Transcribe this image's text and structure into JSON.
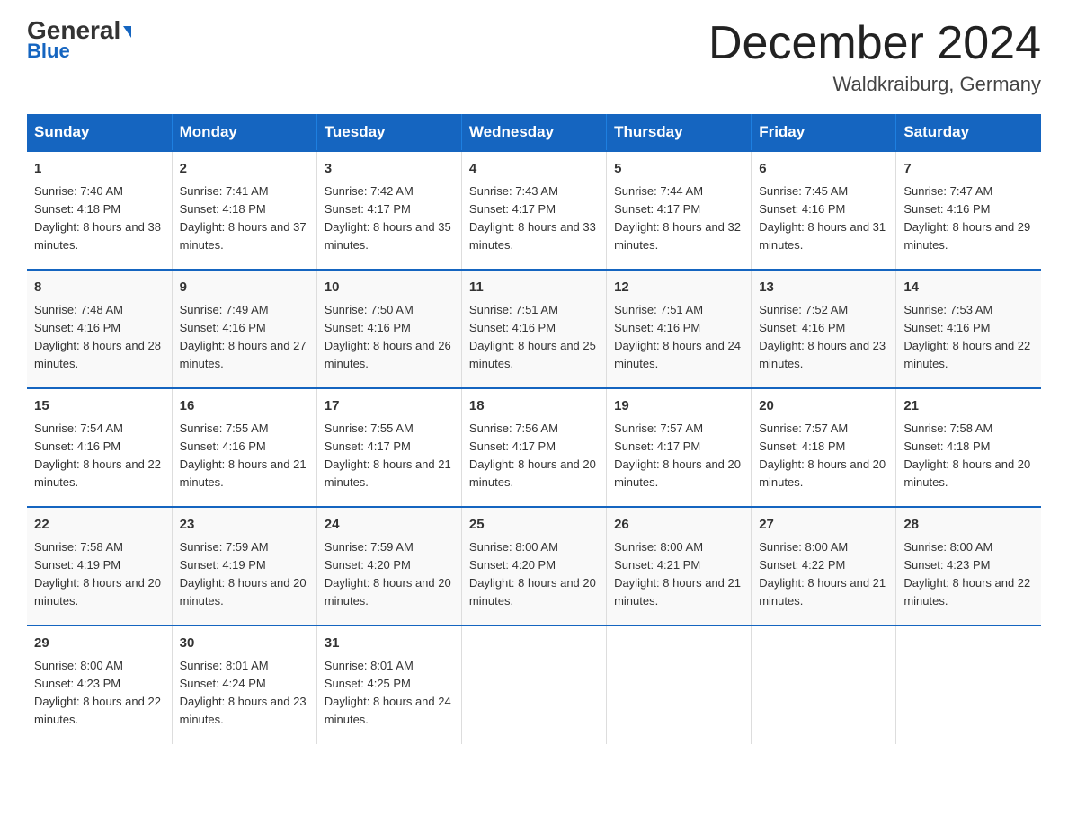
{
  "logo": {
    "general": "General",
    "arrow": "▶",
    "blue": "Blue"
  },
  "header": {
    "month": "December 2024",
    "location": "Waldkraiburg, Germany"
  },
  "days_of_week": [
    "Sunday",
    "Monday",
    "Tuesday",
    "Wednesday",
    "Thursday",
    "Friday",
    "Saturday"
  ],
  "weeks": [
    [
      {
        "day": "1",
        "sunrise": "7:40 AM",
        "sunset": "4:18 PM",
        "daylight": "8 hours and 38 minutes."
      },
      {
        "day": "2",
        "sunrise": "7:41 AM",
        "sunset": "4:18 PM",
        "daylight": "8 hours and 37 minutes."
      },
      {
        "day": "3",
        "sunrise": "7:42 AM",
        "sunset": "4:17 PM",
        "daylight": "8 hours and 35 minutes."
      },
      {
        "day": "4",
        "sunrise": "7:43 AM",
        "sunset": "4:17 PM",
        "daylight": "8 hours and 33 minutes."
      },
      {
        "day": "5",
        "sunrise": "7:44 AM",
        "sunset": "4:17 PM",
        "daylight": "8 hours and 32 minutes."
      },
      {
        "day": "6",
        "sunrise": "7:45 AM",
        "sunset": "4:16 PM",
        "daylight": "8 hours and 31 minutes."
      },
      {
        "day": "7",
        "sunrise": "7:47 AM",
        "sunset": "4:16 PM",
        "daylight": "8 hours and 29 minutes."
      }
    ],
    [
      {
        "day": "8",
        "sunrise": "7:48 AM",
        "sunset": "4:16 PM",
        "daylight": "8 hours and 28 minutes."
      },
      {
        "day": "9",
        "sunrise": "7:49 AM",
        "sunset": "4:16 PM",
        "daylight": "8 hours and 27 minutes."
      },
      {
        "day": "10",
        "sunrise": "7:50 AM",
        "sunset": "4:16 PM",
        "daylight": "8 hours and 26 minutes."
      },
      {
        "day": "11",
        "sunrise": "7:51 AM",
        "sunset": "4:16 PM",
        "daylight": "8 hours and 25 minutes."
      },
      {
        "day": "12",
        "sunrise": "7:51 AM",
        "sunset": "4:16 PM",
        "daylight": "8 hours and 24 minutes."
      },
      {
        "day": "13",
        "sunrise": "7:52 AM",
        "sunset": "4:16 PM",
        "daylight": "8 hours and 23 minutes."
      },
      {
        "day": "14",
        "sunrise": "7:53 AM",
        "sunset": "4:16 PM",
        "daylight": "8 hours and 22 minutes."
      }
    ],
    [
      {
        "day": "15",
        "sunrise": "7:54 AM",
        "sunset": "4:16 PM",
        "daylight": "8 hours and 22 minutes."
      },
      {
        "day": "16",
        "sunrise": "7:55 AM",
        "sunset": "4:16 PM",
        "daylight": "8 hours and 21 minutes."
      },
      {
        "day": "17",
        "sunrise": "7:55 AM",
        "sunset": "4:17 PM",
        "daylight": "8 hours and 21 minutes."
      },
      {
        "day": "18",
        "sunrise": "7:56 AM",
        "sunset": "4:17 PM",
        "daylight": "8 hours and 20 minutes."
      },
      {
        "day": "19",
        "sunrise": "7:57 AM",
        "sunset": "4:17 PM",
        "daylight": "8 hours and 20 minutes."
      },
      {
        "day": "20",
        "sunrise": "7:57 AM",
        "sunset": "4:18 PM",
        "daylight": "8 hours and 20 minutes."
      },
      {
        "day": "21",
        "sunrise": "7:58 AM",
        "sunset": "4:18 PM",
        "daylight": "8 hours and 20 minutes."
      }
    ],
    [
      {
        "day": "22",
        "sunrise": "7:58 AM",
        "sunset": "4:19 PM",
        "daylight": "8 hours and 20 minutes."
      },
      {
        "day": "23",
        "sunrise": "7:59 AM",
        "sunset": "4:19 PM",
        "daylight": "8 hours and 20 minutes."
      },
      {
        "day": "24",
        "sunrise": "7:59 AM",
        "sunset": "4:20 PM",
        "daylight": "8 hours and 20 minutes."
      },
      {
        "day": "25",
        "sunrise": "8:00 AM",
        "sunset": "4:20 PM",
        "daylight": "8 hours and 20 minutes."
      },
      {
        "day": "26",
        "sunrise": "8:00 AM",
        "sunset": "4:21 PM",
        "daylight": "8 hours and 21 minutes."
      },
      {
        "day": "27",
        "sunrise": "8:00 AM",
        "sunset": "4:22 PM",
        "daylight": "8 hours and 21 minutes."
      },
      {
        "day": "28",
        "sunrise": "8:00 AM",
        "sunset": "4:23 PM",
        "daylight": "8 hours and 22 minutes."
      }
    ],
    [
      {
        "day": "29",
        "sunrise": "8:00 AM",
        "sunset": "4:23 PM",
        "daylight": "8 hours and 22 minutes."
      },
      {
        "day": "30",
        "sunrise": "8:01 AM",
        "sunset": "4:24 PM",
        "daylight": "8 hours and 23 minutes."
      },
      {
        "day": "31",
        "sunrise": "8:01 AM",
        "sunset": "4:25 PM",
        "daylight": "8 hours and 24 minutes."
      },
      null,
      null,
      null,
      null
    ]
  ]
}
